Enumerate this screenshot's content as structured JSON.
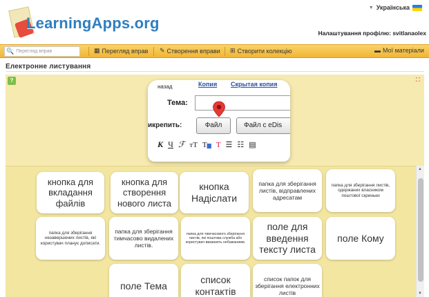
{
  "header": {
    "logo_text": "LearningApps.org",
    "language": "Українська",
    "profile_label": "Налаштування профілю: svitlanaolex"
  },
  "navbar": {
    "search_placeholder": "Перегляд вправ",
    "browse_label": "Перегляд вправ",
    "create_app_label": "Створення вправи",
    "create_collection_label": "Створити колекцію",
    "my_materials_label": "Мої матеріали"
  },
  "page": {
    "title": "Електронне листування"
  },
  "snapshot": {
    "back": "назад",
    "copy_link": "Копия",
    "hidden_copy_link": "Скрытая копия",
    "subject_label": "Тема:",
    "attach_label": "икрепить:",
    "file_button": "Файл",
    "file_edisk_button": "Файл с eDis"
  },
  "answers": [
    "кнопка для вкладання файлів",
    "кнопка для створення нового листа",
    "кнопка Надіслати",
    "папка для зберігання листів, відправлених адресатам",
    "папка для зберігання листів, одержаних власником поштової скриньки",
    "папка для зберігання незавершених листів, які користувач планує дописати.",
    "папка для зберігання тимчасово видалених листів.",
    "папка для тимчасового зберігання листів, які поштова служба або користувач вважають небажаними.",
    "поле для введення тексту листа",
    "поле Кому",
    "поле Тема",
    "список контактів",
    "список папок для зберігання електронних листів"
  ],
  "colors": {
    "navbar": "#f1b535",
    "app_background": "#f4e8a3",
    "logo": "#2f7ec0",
    "link": "#2a4fa0",
    "pin": "#e53935"
  }
}
